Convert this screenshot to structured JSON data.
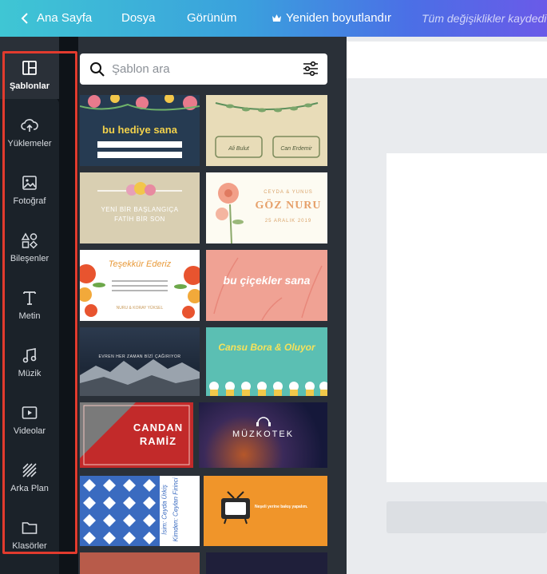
{
  "topbar": {
    "home": "Ana Sayfa",
    "file": "Dosya",
    "view": "Görünüm",
    "resize": "Yeniden boyutlandır",
    "status": "Tüm değişiklikler kaydedi"
  },
  "sidebar": {
    "items": [
      {
        "label": "Şablonlar",
        "icon": "layout-icon"
      },
      {
        "label": "Yüklemeler",
        "icon": "cloud-upload-icon"
      },
      {
        "label": "Fotoğraf",
        "icon": "image-icon"
      },
      {
        "label": "Bileşenler",
        "icon": "shapes-icon"
      },
      {
        "label": "Metin",
        "icon": "text-icon"
      },
      {
        "label": "Müzik",
        "icon": "music-icon"
      },
      {
        "label": "Videolar",
        "icon": "video-icon"
      },
      {
        "label": "Arka Plan",
        "icon": "pattern-icon"
      },
      {
        "label": "Klasörler",
        "icon": "folder-icon"
      }
    ]
  },
  "search": {
    "placeholder": "Şablon ara"
  },
  "templates": {
    "t1": {
      "title": "bu hediye sana"
    },
    "t2": {
      "left": "Ali Bulut",
      "right": "Can Erdemir"
    },
    "t3": {
      "line1": "YENİ BİR BAŞLANGIÇA",
      "line2": "FATİH BİR SON"
    },
    "t4": {
      "names": "CEYDA & YUNUS",
      "title": "GÖZ NURU",
      "date": "25 ARALIK 2019"
    },
    "t5": {
      "title": "Teşekkür Ederiz",
      "names": "NURU & KORAY YÜKSEL"
    },
    "t6": {
      "title": "bu çiçekler sana"
    },
    "t7": {
      "text": "EVREN HER ZAMAN BİZİ ÇAĞIRIYOR"
    },
    "t8": {
      "title": "Cansu Bora & Oluyor"
    },
    "t9": {
      "line1": "CANDAN",
      "line2": "RAMİZ"
    },
    "t10": {
      "title": "MÜZKOTEK"
    },
    "t11": {
      "line1": "İsim: Ceyda Ürkiş",
      "line2": "Kimden: Ceylan Firinci"
    },
    "t12": {
      "text": "Neşeli yerine bakış yapalım."
    }
  },
  "colors": {
    "accent_red": "#e23b2e",
    "sidebar_bg": "#0e1318",
    "panel_bg": "#2a3038"
  }
}
